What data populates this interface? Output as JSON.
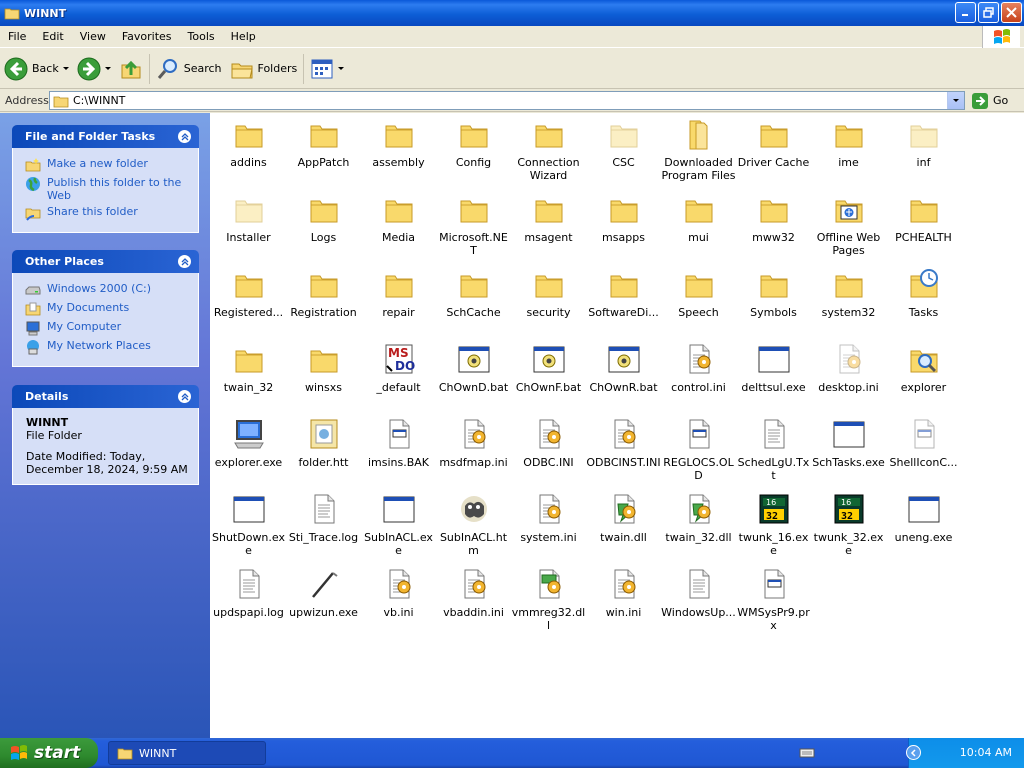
{
  "window": {
    "title": "WINNT"
  },
  "menu": [
    "File",
    "Edit",
    "View",
    "Favorites",
    "Tools",
    "Help"
  ],
  "toolbar": {
    "back": "Back",
    "search": "Search",
    "folders": "Folders"
  },
  "address": {
    "label": "Address",
    "value": "C:\\WINNT",
    "go": "Go"
  },
  "tasks": {
    "file_folder": {
      "title": "File and Folder Tasks",
      "items": [
        "Make a new folder",
        "Publish this folder to the Web",
        "Share this folder"
      ]
    },
    "other_places": {
      "title": "Other Places",
      "items": [
        "Windows 2000 (C:)",
        "My Documents",
        "My Computer",
        "My Network Places"
      ]
    },
    "details": {
      "title": "Details",
      "name": "WINNT",
      "type": "File Folder",
      "modified": "Date Modified: Today, December 18, 2024, 9:59 AM"
    }
  },
  "files": [
    {
      "name": "addins",
      "icon": "folder"
    },
    {
      "name": "AppPatch",
      "icon": "folder"
    },
    {
      "name": "assembly",
      "icon": "folder"
    },
    {
      "name": "Config",
      "icon": "folder"
    },
    {
      "name": "Connection Wizard",
      "icon": "folder"
    },
    {
      "name": "CSC",
      "icon": "folder-faded"
    },
    {
      "name": "Downloaded Program Files",
      "icon": "folder-open"
    },
    {
      "name": "Driver Cache",
      "icon": "folder"
    },
    {
      "name": "ime",
      "icon": "folder"
    },
    {
      "name": "inf",
      "icon": "folder-faded"
    },
    {
      "name": "Installer",
      "icon": "folder-faded"
    },
    {
      "name": "Logs",
      "icon": "folder"
    },
    {
      "name": "Media",
      "icon": "folder"
    },
    {
      "name": "Microsoft.NET",
      "icon": "folder"
    },
    {
      "name": "msagent",
      "icon": "folder"
    },
    {
      "name": "msapps",
      "icon": "folder"
    },
    {
      "name": "mui",
      "icon": "folder"
    },
    {
      "name": "mww32",
      "icon": "folder"
    },
    {
      "name": "Offline Web Pages",
      "icon": "folder-web"
    },
    {
      "name": "PCHEALTH",
      "icon": "folder"
    },
    {
      "name": "Registered...",
      "icon": "folder"
    },
    {
      "name": "Registration",
      "icon": "folder"
    },
    {
      "name": "repair",
      "icon": "folder"
    },
    {
      "name": "SchCache",
      "icon": "folder"
    },
    {
      "name": "security",
      "icon": "folder"
    },
    {
      "name": "SoftwareDi...",
      "icon": "folder"
    },
    {
      "name": "Speech",
      "icon": "folder"
    },
    {
      "name": "Symbols",
      "icon": "folder"
    },
    {
      "name": "system32",
      "icon": "folder"
    },
    {
      "name": "Tasks",
      "icon": "folder-tasks"
    },
    {
      "name": "twain_32",
      "icon": "folder"
    },
    {
      "name": "winsxs",
      "icon": "folder"
    },
    {
      "name": "_default",
      "icon": "msdos"
    },
    {
      "name": "ChOwnD.bat",
      "icon": "bat"
    },
    {
      "name": "ChOwnF.bat",
      "icon": "bat"
    },
    {
      "name": "ChOwnR.bat",
      "icon": "bat"
    },
    {
      "name": "control.ini",
      "icon": "ini"
    },
    {
      "name": "delttsul.exe",
      "icon": "exe"
    },
    {
      "name": "desktop.ini",
      "icon": "ini-faded"
    },
    {
      "name": "explorer",
      "icon": "folder-search"
    },
    {
      "name": "explorer.exe",
      "icon": "computer"
    },
    {
      "name": "folder.htt",
      "icon": "htt"
    },
    {
      "name": "imsins.BAK",
      "icon": "generic"
    },
    {
      "name": "msdfmap.ini",
      "icon": "ini"
    },
    {
      "name": "ODBC.INI",
      "icon": "ini"
    },
    {
      "name": "ODBCINST.INI",
      "icon": "ini"
    },
    {
      "name": "REGLOCS.OLD",
      "icon": "generic"
    },
    {
      "name": "SchedLgU.Txt",
      "icon": "text"
    },
    {
      "name": "SchTasks.exe",
      "icon": "exe"
    },
    {
      "name": "ShellIconC...",
      "icon": "generic-faded"
    },
    {
      "name": "ShutDown.exe",
      "icon": "exe"
    },
    {
      "name": "Sti_Trace.log",
      "icon": "text"
    },
    {
      "name": "SubInACL.exe",
      "icon": "exe"
    },
    {
      "name": "SubInACL.htm",
      "icon": "htm"
    },
    {
      "name": "system.ini",
      "icon": "ini"
    },
    {
      "name": "twain.dll",
      "icon": "dll"
    },
    {
      "name": "twain_32.dll",
      "icon": "dll"
    },
    {
      "name": "twunk_16.exe",
      "icon": "twunk-16"
    },
    {
      "name": "twunk_32.exe",
      "icon": "twunk-32"
    },
    {
      "name": "uneng.exe",
      "icon": "exe"
    },
    {
      "name": "updspapi.log",
      "icon": "text"
    },
    {
      "name": "upwizun.exe",
      "icon": "wand"
    },
    {
      "name": "vb.ini",
      "icon": "ini"
    },
    {
      "name": "vbaddin.ini",
      "icon": "ini"
    },
    {
      "name": "vmmreg32.dll",
      "icon": "dll-green"
    },
    {
      "name": "win.ini",
      "icon": "ini"
    },
    {
      "name": "WindowsUp...",
      "icon": "text"
    },
    {
      "name": "WMSysPr9.prx",
      "icon": "generic"
    }
  ],
  "taskbar": {
    "start": "start",
    "task": "WINNT",
    "clock": "10:04 AM"
  }
}
